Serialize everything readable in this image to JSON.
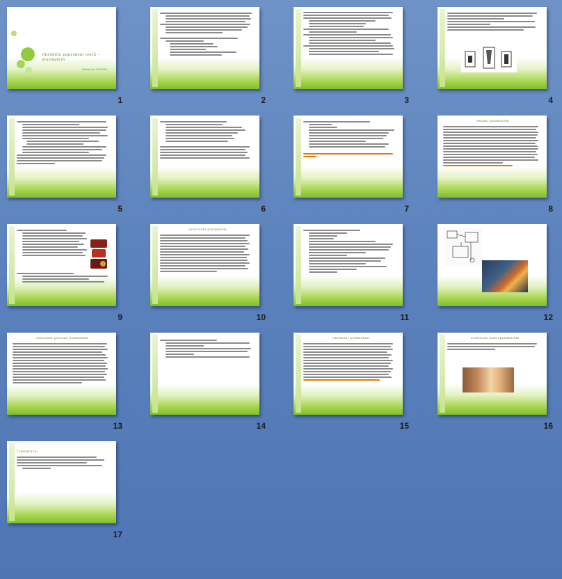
{
  "slides": [
    {
      "number": "1",
      "title": "Obrábění paprskem iontů – plazmatem",
      "subtitle": "Kateřina Bc. DOKOUPIL"
    },
    {
      "number": "2"
    },
    {
      "number": "3"
    },
    {
      "number": "4"
    },
    {
      "number": "5"
    },
    {
      "number": "6"
    },
    {
      "number": "7"
    },
    {
      "number": "8",
      "title": "Řezání plazmatem"
    },
    {
      "number": "9"
    },
    {
      "number": "10",
      "title": "Svařování plazmatem"
    },
    {
      "number": "11"
    },
    {
      "number": "12"
    },
    {
      "number": "13",
      "title": "Nanášení povlaků plazmatem"
    },
    {
      "number": "14"
    },
    {
      "number": "15",
      "title": "Obrábění plazmatem"
    },
    {
      "number": "16",
      "title": "Svařování mikroplazmatem"
    },
    {
      "number": "17",
      "title": "Literatura:"
    }
  ],
  "colors": {
    "accent_green": "#7fbe2c",
    "title_green": "#6b8c3a",
    "background_blue": "#5c82bd",
    "link_orange": "#e07b00"
  }
}
